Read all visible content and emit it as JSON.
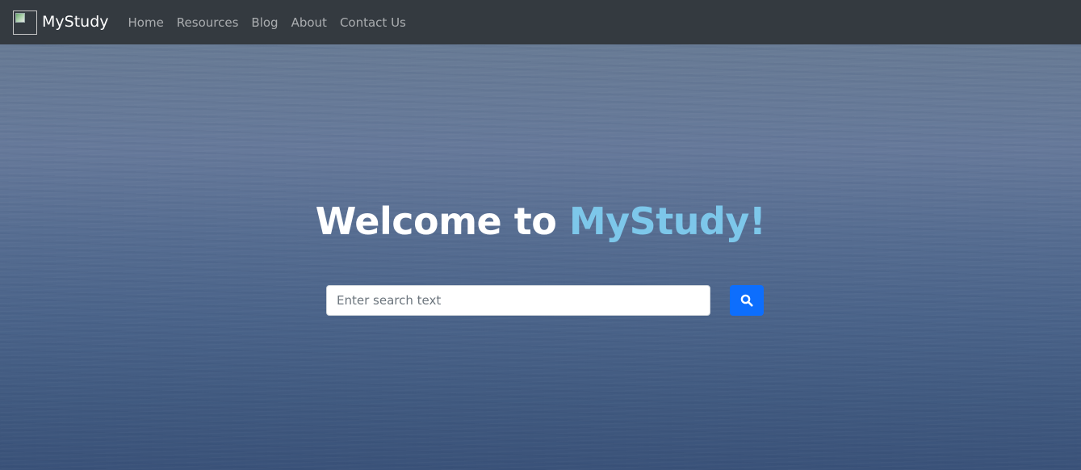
{
  "navbar": {
    "brand": "MyStudy",
    "links": [
      "Home",
      "Resources",
      "Blog",
      "About",
      "Contact Us"
    ]
  },
  "hero": {
    "heading_main": "Welcome to ",
    "heading_accent": "MyStudy!",
    "accent_color": "#7dc7ea"
  },
  "search": {
    "placeholder": "Enter search text",
    "value": "",
    "button_icon": "search-icon",
    "button_color": "#0d6efd"
  },
  "colors": {
    "navbar_bg": "#343a40",
    "background_top": "#687b95",
    "background_bottom": "#3a5279"
  }
}
